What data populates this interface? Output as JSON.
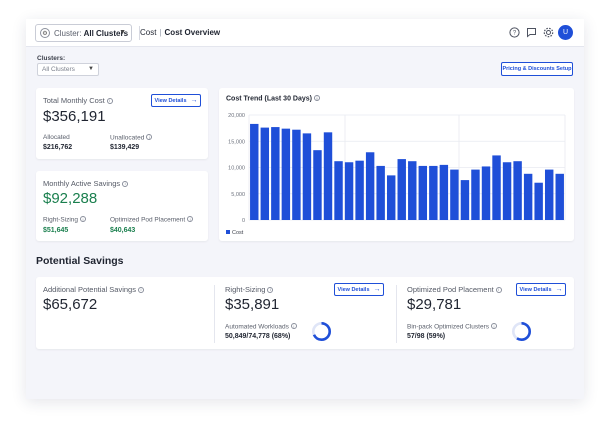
{
  "topbar": {
    "cluster_label": "Cluster:",
    "cluster_value": "All Clusters",
    "breadcrumb_root": "Cost",
    "breadcrumb_sep": "|",
    "breadcrumb_current": "Cost Overview",
    "avatar_initial": "U",
    "icons": [
      "help-icon",
      "chat-icon",
      "gear-icon"
    ]
  },
  "filters": {
    "label": "Clusters:",
    "value": "All Clusters",
    "pricing_button": "Pricing & Discounts Setup"
  },
  "total_cost": {
    "title": "Total Monthly Cost",
    "value": "$356,191",
    "button": "View Details",
    "allocated_label": "Allocated",
    "allocated_value": "$216,762",
    "unallocated_label": "Unallocated",
    "unallocated_value": "$139,429"
  },
  "savings": {
    "title": "Monthly Active Savings",
    "value": "$92,288",
    "rightsizing_label": "Right-Sizing",
    "rightsizing_value": "$51,645",
    "pod_label": "Optimized Pod Placement",
    "pod_value": "$40,643"
  },
  "chart_data": {
    "type": "bar",
    "title": "Cost Trend (Last 30 Days)",
    "yticks": [
      "20,000",
      "15,000",
      "10,000",
      "5,000",
      "0"
    ],
    "ylim": [
      0,
      20000
    ],
    "legend": "Cost",
    "legend_position": "bottom-left",
    "grid": true,
    "color": "#1f4fd8",
    "values": [
      18300,
      17600,
      17700,
      17400,
      17200,
      16500,
      13300,
      16700,
      11200,
      11000,
      11300,
      12900,
      10300,
      8500,
      11600,
      11200,
      10300,
      10300,
      10500,
      9600,
      7600,
      9600,
      10200,
      12300,
      11000,
      11200,
      8800,
      7100,
      9600,
      8800
    ]
  },
  "potential": {
    "section_title": "Potential Savings",
    "additional_title": "Additional Potential Savings",
    "additional_value": "$65,672",
    "rightsizing_title": "Right-Sizing",
    "rightsizing_value": "$35,891",
    "rightsizing_button": "View Details",
    "workloads_label": "Automated Workloads",
    "workloads_value": "50,849/74,778 (68%)",
    "workloads_fraction": 0.68,
    "pod_title": "Optimized Pod Placement",
    "pod_value": "$29,781",
    "pod_button": "View Details",
    "binpack_label": "Bin-pack Optimized Clusters",
    "binpack_value": "57/98 (59%)",
    "binpack_fraction": 0.59
  }
}
